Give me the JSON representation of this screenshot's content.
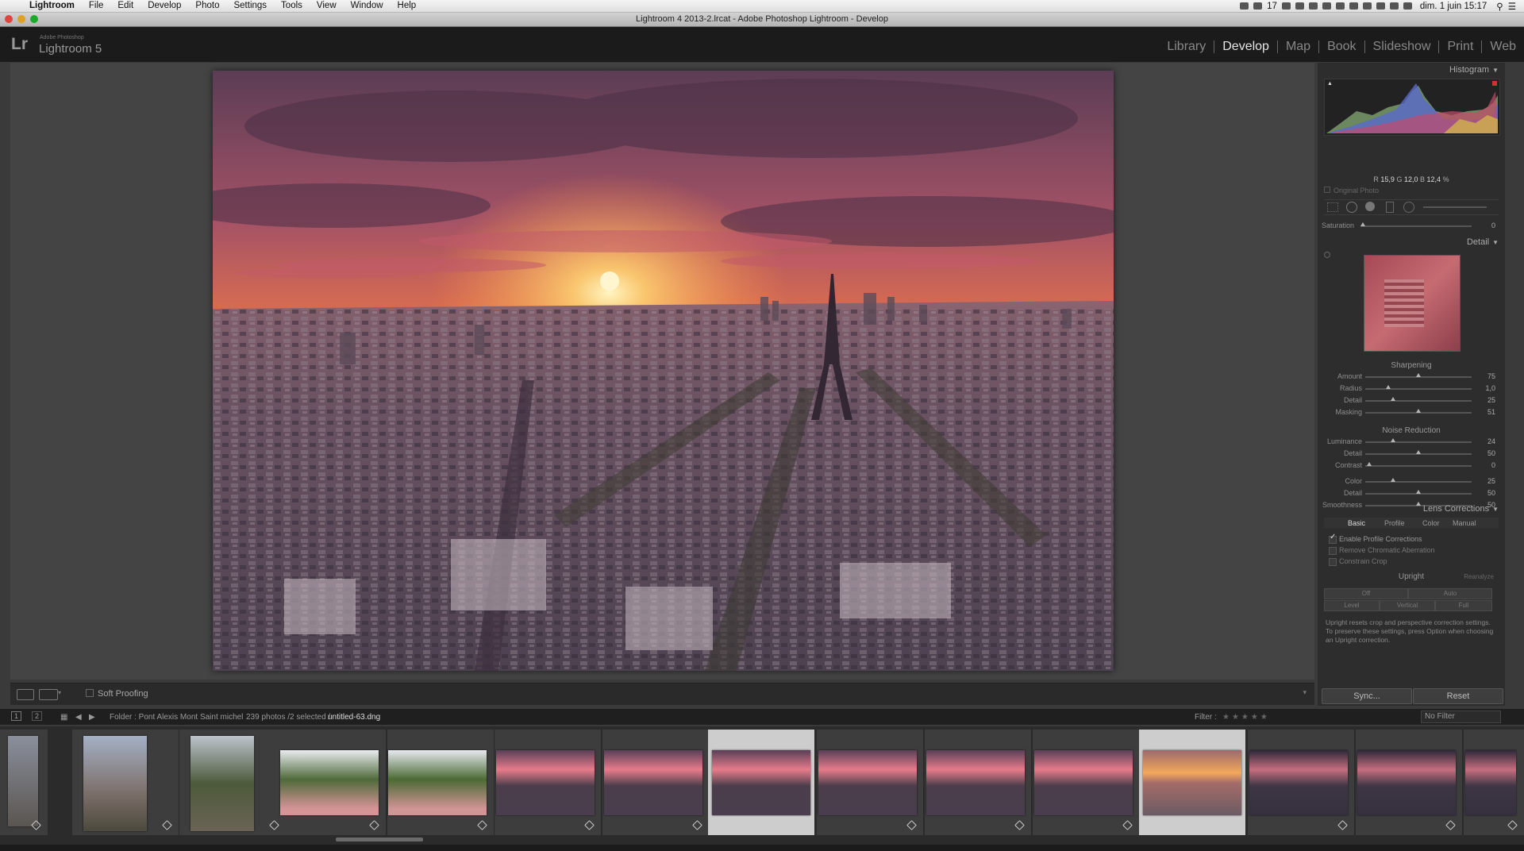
{
  "menubar": {
    "app": "Lightroom",
    "items": [
      "File",
      "Edit",
      "Develop",
      "Photo",
      "Settings",
      "Tools",
      "View",
      "Window",
      "Help"
    ],
    "clock": "dim. 1 juin  15:17",
    "badge_count": "17"
  },
  "window": {
    "title": "Lightroom 4 2013-2.lrcat - Adobe Photoshop Lightroom - Develop"
  },
  "header": {
    "logo_mark": "Lr",
    "logo_small": "Adobe Photoshop",
    "logo_name": "Lightroom 5",
    "modules": [
      {
        "label": "Library",
        "active": false
      },
      {
        "label": "Develop",
        "active": true
      },
      {
        "label": "Map",
        "active": false
      },
      {
        "label": "Book",
        "active": false
      },
      {
        "label": "Slideshow",
        "active": false
      },
      {
        "label": "Print",
        "active": false
      },
      {
        "label": "Web",
        "active": false
      }
    ]
  },
  "toolbar": {
    "soft_proofing": "Soft Proofing"
  },
  "panel": {
    "histogram_title": "Histogram",
    "rgb": {
      "r_label": "R",
      "r": "15,9",
      "g_label": "G",
      "g": "12,0",
      "b_label": "B",
      "b": "12,4",
      "unit": "%"
    },
    "original_photo": "Original Photo",
    "saturation_label": "Saturation",
    "saturation_value": "0",
    "detail_title": "Detail",
    "sharpening_title": "Sharpening",
    "sharpening": [
      {
        "label": "Amount",
        "value": "75",
        "pos": 0.5
      },
      {
        "label": "Radius",
        "value": "1,0",
        "pos": 0.22
      },
      {
        "label": "Detail",
        "value": "25",
        "pos": 0.26
      },
      {
        "label": "Masking",
        "value": "51",
        "pos": 0.5
      }
    ],
    "noise_title": "Noise Reduction",
    "noise": [
      {
        "label": "Luminance",
        "value": "24",
        "pos": 0.26
      },
      {
        "label": "Detail",
        "value": "50",
        "pos": 0.5
      },
      {
        "label": "Contrast",
        "value": "0",
        "pos": 0.04
      },
      {
        "label": "Color",
        "value": "25",
        "pos": 0.26
      },
      {
        "label": "Detail",
        "value": "50",
        "pos": 0.5
      },
      {
        "label": "Smoothness",
        "value": "50",
        "pos": 0.5
      }
    ],
    "lens_title": "Lens Corrections",
    "lens_tabs": [
      "Basic",
      "Profile",
      "Color",
      "Manual"
    ],
    "lens_checks": [
      {
        "label": "Enable Profile Corrections",
        "checked": true
      },
      {
        "label": "Remove Chromatic Aberration",
        "checked": false
      },
      {
        "label": "Constrain Crop",
        "checked": false
      }
    ],
    "upright_title": "Upright",
    "upright_reanalyze": "Reanalyze",
    "upright_buttons": [
      "Off",
      "Auto",
      "Level",
      "Vertical",
      "Full"
    ],
    "upright_help": "Upright resets crop and perspective correction settings. To preserve these settings, press Option when choosing an Upright correction.",
    "sync": "Sync...",
    "reset": "Reset"
  },
  "filmstrip": {
    "view1": "1",
    "view2": "2",
    "folder": "Folder : Pont Alexis Mont Saint michel",
    "count": "239 photos /2 selected /",
    "filename": "untitled-63.dng",
    "filter_label": "Filter :",
    "filter_value": "No Filter"
  },
  "colors": {
    "chrome": "#1b1b1b",
    "panel": "#2d2d2d",
    "active_module": "#e6e6e6",
    "sunset_orange": "#f08a3c"
  }
}
